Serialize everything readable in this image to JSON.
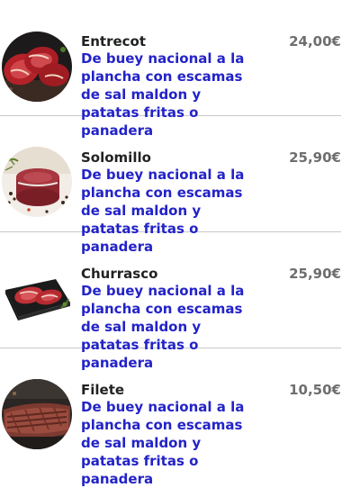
{
  "menu": {
    "items": [
      {
        "name": "Entrecot",
        "description": "De buey nacional a la plancha con escamas de sal maldon y patatas fritas o panadera",
        "price": "24,00€",
        "icon": "steak-photo"
      },
      {
        "name": "Solomillo",
        "description": "De buey nacional a la plancha con escamas de sal maldon y patatas fritas o panadera",
        "price": "25,90€",
        "icon": "tenderloin-photo"
      },
      {
        "name": "Churrasco",
        "description": "De buey nacional a la plancha con escamas de sal maldon y patatas fritas o panadera",
        "price": "25,90€",
        "icon": "churrasco-photo"
      },
      {
        "name": "Filete",
        "description": "De buey nacional a la plancha con escamas de sal maldon y patatas fritas o panadera",
        "price": "10,50€",
        "icon": "fillet-photo"
      }
    ]
  },
  "colors": {
    "name": "#222222",
    "description": "#2323c8",
    "price": "#6e6e6e",
    "divider": "#c8c8c8"
  }
}
